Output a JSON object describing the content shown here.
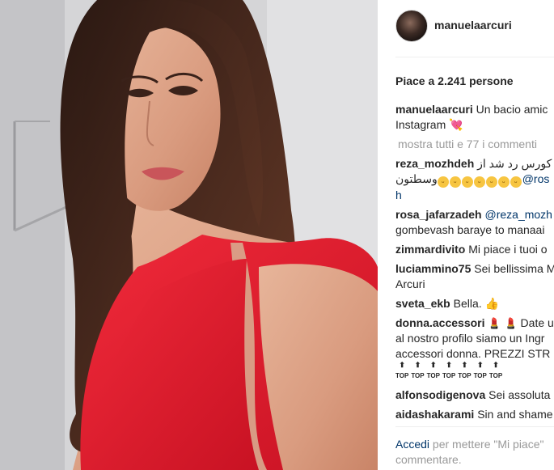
{
  "post": {
    "username": "manuelaarcuri",
    "likes_text": "Piace a 2.241 persone",
    "caption_user": "manuelaarcuri",
    "caption_text": "Un bacio amic",
    "caption_text2": "Instagram",
    "view_all": "mostra tutti e 77 i commenti"
  },
  "comments": [
    {
      "user": "reza_mozhdeh",
      "text": "ه کورس رد شد از",
      "line2_mention": "@ros",
      "line2_tail": "وسطتون",
      "line3": "h"
    },
    {
      "user": "rosa_jafarzadeh",
      "mention": "@reza_mozh",
      "line2": "gombevash baraye to manaai"
    },
    {
      "user": "zimmardivito",
      "text": "Mi piace i tuoi o"
    },
    {
      "user": "luciammino75",
      "text": "Sei bellissima M",
      "line2": "Arcuri"
    },
    {
      "user": "sveta_ekb",
      "text": "Bella."
    },
    {
      "user": "donna.accessori",
      "text": "Date u",
      "line2": "al nostro profilo siamo un Ingr",
      "line3": "accessori donna. PREZZI STR",
      "tops": [
        "TOP",
        "TOP",
        "TOP",
        "TOP",
        "TOP",
        "TOP",
        "TOP"
      ]
    },
    {
      "user": "alfonsodigenova",
      "text": "Sei assoluta"
    },
    {
      "user": "aidashakarami",
      "text": "Sin and shame"
    }
  ],
  "footer": {
    "login_link": "Accedi",
    "login_text": "per mettere \"Mi piace\"",
    "login_text2": "commentare."
  },
  "colors": {
    "link": "#003569",
    "muted": "#999999",
    "text": "#262626",
    "dress": "#e0182b"
  },
  "icons": [
    "profile-avatar",
    "heart-emoji",
    "laughing-emoji",
    "thumbs-up-emoji",
    "lipstick-emoji",
    "top-arrow-emoji"
  ]
}
